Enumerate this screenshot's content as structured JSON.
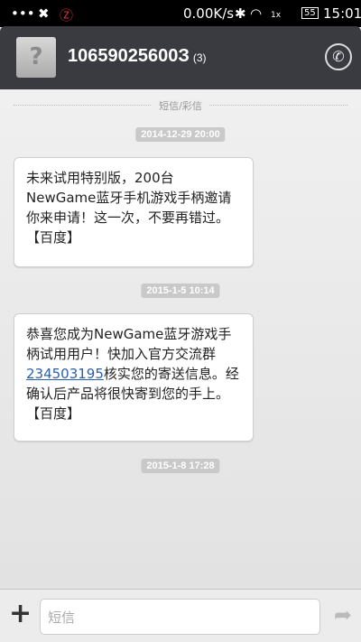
{
  "status_bar": {
    "speed": "0.00K/s",
    "network": "1x",
    "battery": "55",
    "time": "15:01"
  },
  "header": {
    "number": "10659025600З",
    "count": "(3)"
  },
  "divider": "短信/彩信",
  "messages": [
    {
      "time": "2014-12-29 20:00",
      "text": "未来试用特别版，200台NewGame蓝牙手机游戏手柄邀请你来申请！这一次，不要再错过。【百度】"
    },
    {
      "time": "2015-1-5 10:14",
      "text_before": "恭喜您成为NewGame蓝牙游戏手柄试用用户！快加入官方交流群",
      "link": "234503195",
      "text_after": "核实您的寄送信息。经确认后产品将很快寄到您的手上。【百度】"
    }
  ],
  "last_time": "2015-1-8 17:28",
  "composer": {
    "placeholder": "短信"
  }
}
